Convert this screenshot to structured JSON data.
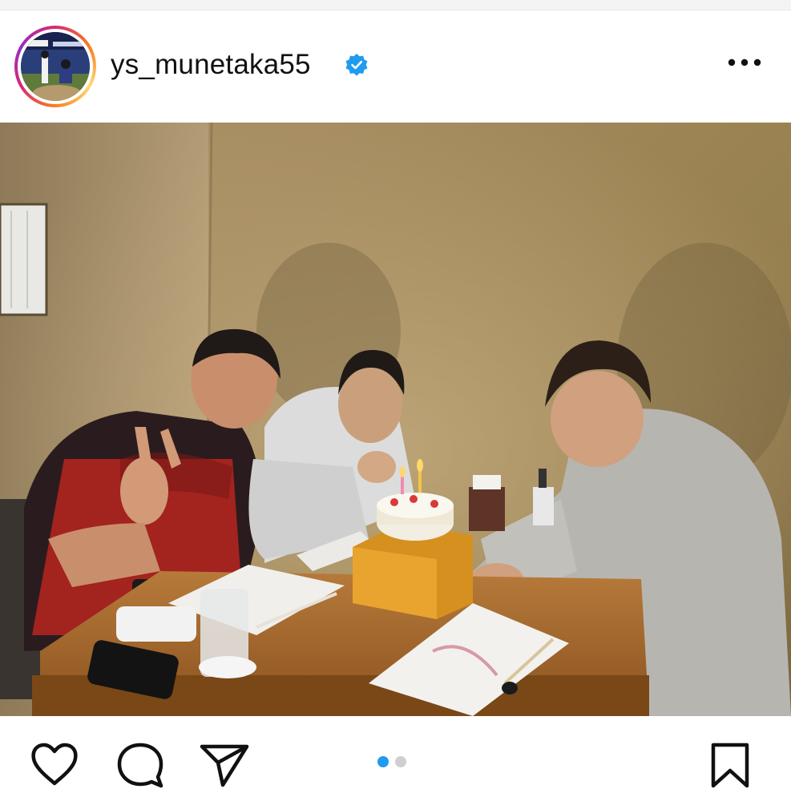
{
  "post": {
    "username": "ys_munetaka55",
    "verified": true
  },
  "icons": {
    "verified": "verified-badge-icon",
    "more": "more-options-icon",
    "like": "heart-icon",
    "comment": "comment-icon",
    "share": "send-icon",
    "save": "bookmark-icon"
  },
  "carousel": {
    "total": 2,
    "active": 1
  },
  "colors": {
    "accent": "#1f9bf0",
    "inactive_dot": "#cfcfcf",
    "icon": "#111111"
  }
}
